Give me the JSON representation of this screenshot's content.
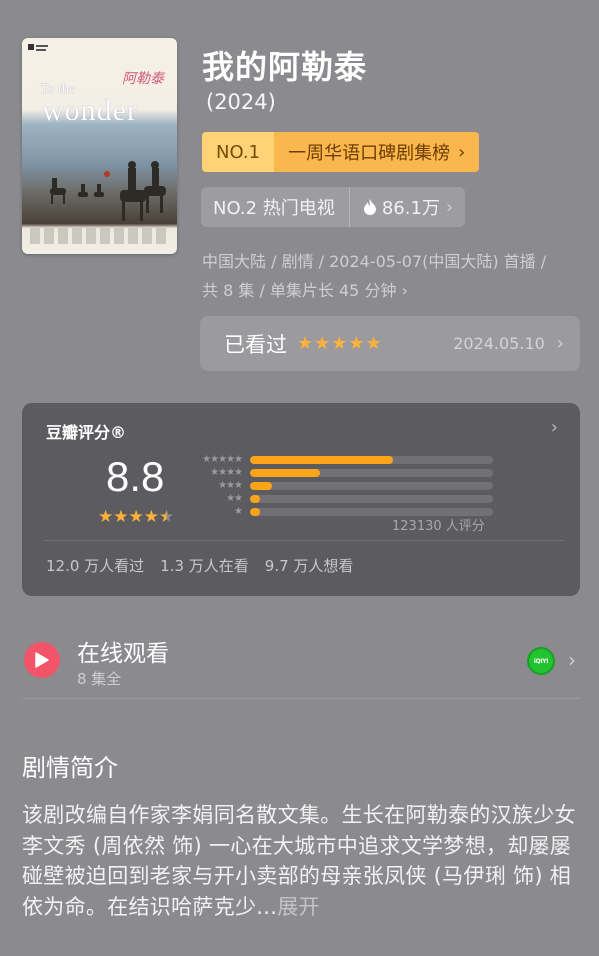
{
  "poster": {
    "title_line1": "To the",
    "title_line2": "wonder",
    "script": "阿勒泰"
  },
  "show": {
    "title": "我的阿勒泰",
    "year": "(2024)",
    "rank1": {
      "no": "NO.1",
      "label": "一周华语口碑剧集榜"
    },
    "rank2": {
      "no_label": "NO.2 热门电视",
      "heat": "86.1万"
    },
    "meta_line1": "中国大陆 / 剧情 / 2024-05-07(中国大陆) 首播 /",
    "meta_line2": "共 8 集 / 单集片长 45 分钟"
  },
  "watched": {
    "label": "已看过",
    "stars": "★★★★★",
    "date": "2024.05.10"
  },
  "rating": {
    "header": "豆瓣评分®",
    "score": "8.8",
    "stars_full": "★★★★",
    "star_half": "★",
    "distribution": [
      {
        "stars": "★★★★★",
        "fraction": 0.59
      },
      {
        "stars": "★★★★",
        "fraction": 0.29
      },
      {
        "stars": "★★★",
        "fraction": 0.09
      },
      {
        "stars": "★★",
        "fraction": 0.04
      },
      {
        "stars": "★",
        "fraction": 0.04
      }
    ],
    "count": "123130 人评分",
    "watched": "12.0 万人看过",
    "watching": "1.3 万人在看",
    "want": "9.7 万人想看"
  },
  "online": {
    "title": "在线观看",
    "subtitle": "8 集全",
    "platform": "iQIYI"
  },
  "synopsis": {
    "title": "剧情简介",
    "text": "该剧改编自作家李娟同名散文集。生长在阿勒泰的汉族少女李文秀 (周依然 饰) 一心在大城市中追求文学梦想，却屡屡碰壁被迫回到老家与开小卖部的母亲张凤侠 (马伊琍 饰) 相依为命。在结识哈萨克少...",
    "more": "展开"
  },
  "colors": {
    "background": "#8b8a8e",
    "accent": "#fcb13b",
    "rank_gold": "#ffd278"
  }
}
